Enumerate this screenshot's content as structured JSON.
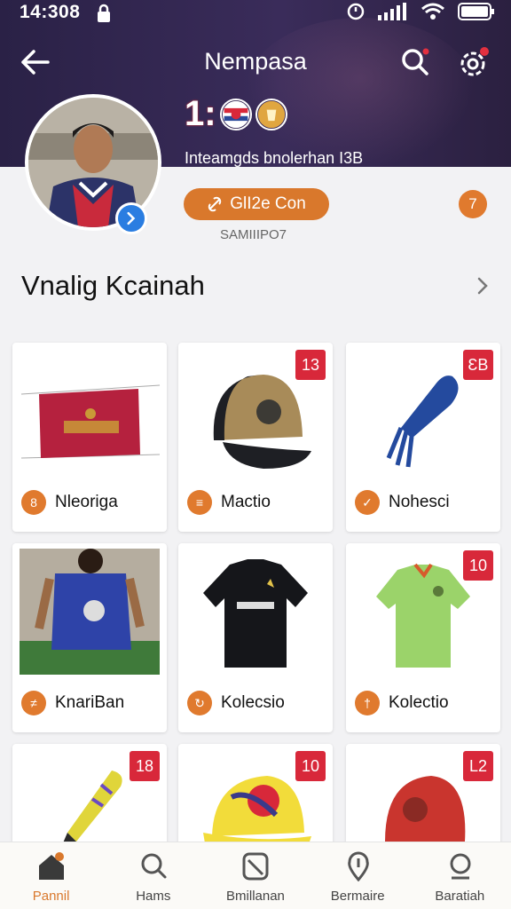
{
  "status_bar": {
    "time": "14:308"
  },
  "header": {
    "title": "Nempasa",
    "score": "1:",
    "subtitle": "Inteamgds bnolerhan I3B"
  },
  "profile": {
    "follow_label": "GlI2e Con",
    "notif_count": "7",
    "handle": "SAMIIIPO7"
  },
  "section": {
    "title": "Vnalig Kcainah"
  },
  "items": [
    {
      "badge": "",
      "name": "Nleorigа"
    },
    {
      "badge": "13",
      "name": "Mactio"
    },
    {
      "badge": "ƐB",
      "name": "Nohesci"
    },
    {
      "badge": "",
      "name": "KnariBan"
    },
    {
      "badge": "",
      "name": "Kolecsio"
    },
    {
      "badge": "10",
      "name": "Kolectio"
    },
    {
      "badge": "18",
      "name": ""
    },
    {
      "badge": "10",
      "name": ""
    },
    {
      "badge": "L2",
      "name": ""
    }
  ],
  "bottom_nav": [
    {
      "label": "Pannil",
      "icon": "home-icon",
      "active": true
    },
    {
      "label": "Hams",
      "icon": "search-icon",
      "active": false
    },
    {
      "label": "Bmillanan",
      "icon": "block-icon",
      "active": false
    },
    {
      "label": "Bermaire",
      "icon": "location-icon",
      "active": false
    },
    {
      "label": "Baratiah",
      "icon": "chat-icon",
      "active": false
    }
  ],
  "colors": {
    "header_bg": "#2a2146",
    "accent": "#d9782c",
    "badge": "#d8283a"
  }
}
